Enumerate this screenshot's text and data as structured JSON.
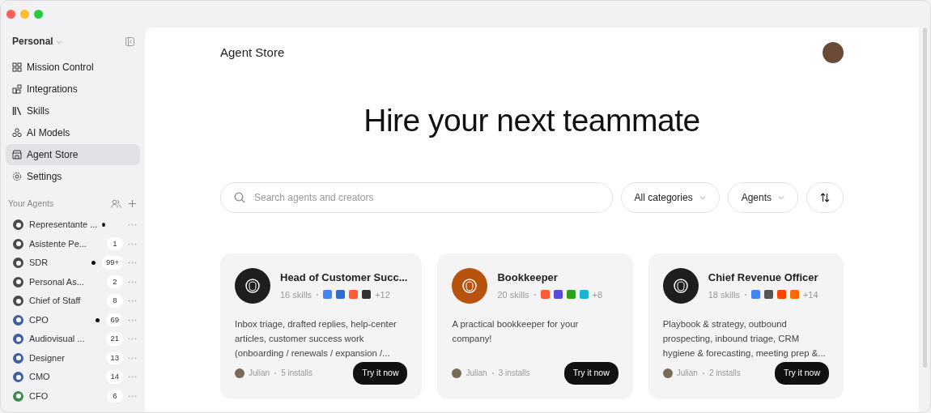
{
  "workspace": {
    "label": "Personal"
  },
  "nav": [
    {
      "label": "Mission Control",
      "selected": false
    },
    {
      "label": "Integrations",
      "selected": false
    },
    {
      "label": "Skills",
      "selected": false
    },
    {
      "label": "AI Models",
      "selected": false
    },
    {
      "label": "Agent Store",
      "selected": true
    },
    {
      "label": "Settings",
      "selected": false
    }
  ],
  "agents_section": {
    "title": "Your Agents"
  },
  "agents": [
    {
      "name": "Representante ...",
      "unread": true,
      "color": "#4a4a4a"
    },
    {
      "name": "Asistente Pe...",
      "unread": false,
      "count": "1",
      "color": "#4a4a4a"
    },
    {
      "name": "SDR",
      "unread": true,
      "count": "99+",
      "color": "#4a4a4a"
    },
    {
      "name": "Personal As...",
      "unread": false,
      "count": "2",
      "color": "#4a4a4a"
    },
    {
      "name": "Chief of Staff",
      "unread": false,
      "count": "8",
      "color": "#4a4a4a"
    },
    {
      "name": "CPO",
      "unread": true,
      "count": "69",
      "color": "#3f5f9e"
    },
    {
      "name": "Audiovisual ...",
      "unread": false,
      "count": "21",
      "color": "#3f5f9e"
    },
    {
      "name": "Designer",
      "unread": false,
      "count": "13",
      "color": "#3f5f9e"
    },
    {
      "name": "CMO",
      "unread": false,
      "count": "14",
      "color": "#3f5f9e"
    },
    {
      "name": "CFO",
      "unread": false,
      "count": "6",
      "color": "#3f8a4e"
    }
  ],
  "header": {
    "title": "Agent Store"
  },
  "hero": {
    "heading": "Hire your next teammate"
  },
  "search": {
    "placeholder": "Search agents and creators"
  },
  "filters": [
    {
      "label": "All categories"
    },
    {
      "label": "Agents"
    }
  ],
  "cards": [
    {
      "title": "Head of Customer Succ...",
      "color": "#1e1e1e",
      "skills": "16 skills",
      "more": "+12",
      "description": "Inbox triage, drafted replies, help-center articles, customer success work (onboarding / renewals / expansion /...",
      "author": "Julian",
      "installs": "5 installs",
      "button": "Try it now"
    },
    {
      "title": "Bookkeeper",
      "color": "#b8520f",
      "skills": "20 skills",
      "more": "+8",
      "description": "A practical bookkeeper for your company!",
      "author": "Julian",
      "installs": "3 installs",
      "button": "Try it now"
    },
    {
      "title": "Chief Revenue Officer",
      "color": "#1e1e1e",
      "skills": "18 skills",
      "more": "+14",
      "description": "Playbook & strategy, outbound prospecting, inbound triage, CRM hygiene & forecasting, meeting prep &...",
      "author": "Julian",
      "installs": "2 installs",
      "button": "Try it now"
    }
  ]
}
